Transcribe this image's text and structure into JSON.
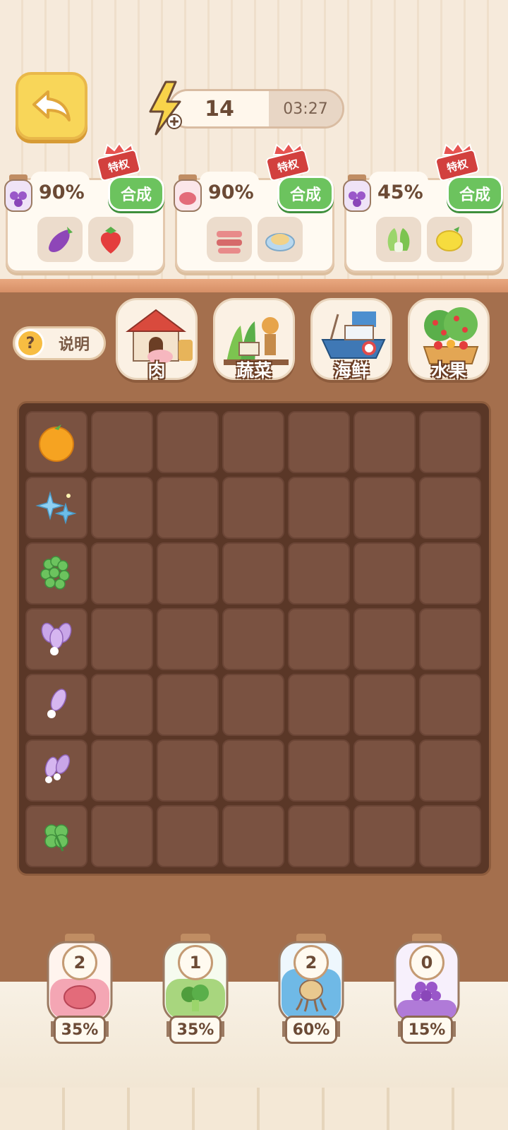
{
  "header": {
    "energy_count": "14",
    "energy_timer": "03:27"
  },
  "recipes": [
    {
      "percent": "90%",
      "synth_label": "合成",
      "privilege_label": "特权",
      "jar_icon": "grape-jar-icon",
      "ingredients": [
        "eggplant-icon",
        "strawberry-icon"
      ]
    },
    {
      "percent": "90%",
      "synth_label": "合成",
      "privilege_label": "特权",
      "jar_icon": "meat-jar-icon",
      "ingredients": [
        "bacon-roll-icon",
        "dumpling-plate-icon"
      ]
    },
    {
      "percent": "45%",
      "synth_label": "合成",
      "privilege_label": "特权",
      "jar_icon": "grape-jar-icon",
      "ingredients": [
        "cabbage-icon",
        "lemon-icon"
      ]
    }
  ],
  "explain_label": "说明",
  "categories": [
    {
      "label": "肉",
      "icon": "farm-barn-icon"
    },
    {
      "label": "蔬菜",
      "icon": "vegetable-garden-icon"
    },
    {
      "label": "海鲜",
      "icon": "fishing-boat-icon"
    },
    {
      "label": "水果",
      "icon": "fruit-tree-icon"
    }
  ],
  "grid_items": [
    "orange-icon",
    "sparkle-stars-icon",
    "clover-bunch-icon",
    "purple-radish-bunch-icon",
    "purple-radish-icon",
    "purple-radish-pair-icon",
    "clover-icon"
  ],
  "jars": [
    {
      "count": "2",
      "percent": "35%",
      "icon": "steak-icon",
      "fill_color": "#f4a6b4"
    },
    {
      "count": "1",
      "percent": "35%",
      "icon": "broccoli-icon",
      "fill_color": "#a8d67e"
    },
    {
      "count": "2",
      "percent": "60%",
      "icon": "octopus-icon",
      "fill_color": "#6fb9e6"
    },
    {
      "count": "0",
      "percent": "15%",
      "icon": "grape-icon",
      "fill_color": "#b07ad8"
    }
  ],
  "colors": {
    "synth_green": "#6cc35e",
    "privilege_red": "#d2403e",
    "board_brown": "#a46f4d",
    "back_yellow": "#f8d659"
  }
}
